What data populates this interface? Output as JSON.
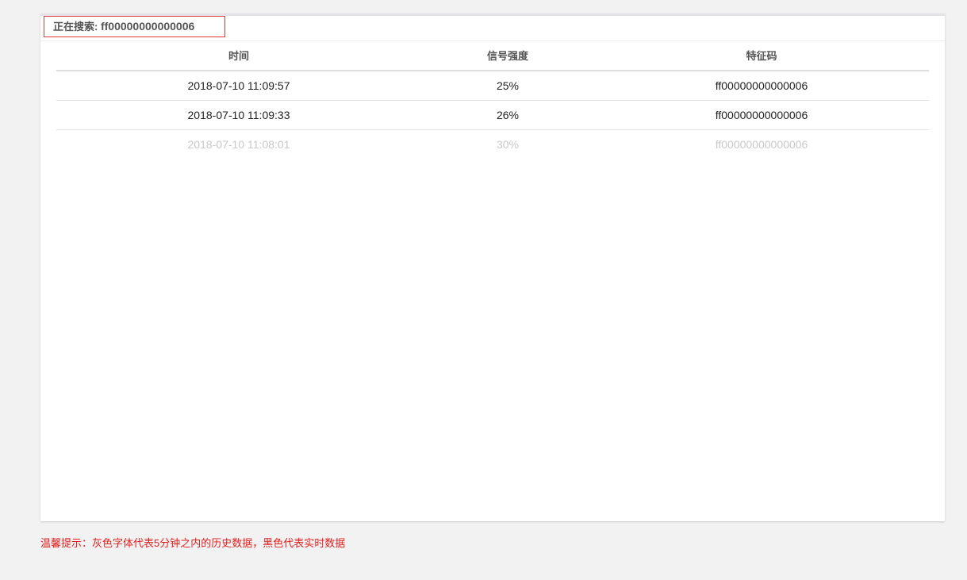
{
  "search": {
    "label": "正在搜索: ",
    "code": "ff00000000000006"
  },
  "table": {
    "headers": [
      "时间",
      "信号强度",
      "特征码"
    ],
    "rows": [
      {
        "time": "2018-07-10 11:09:57",
        "signal": "25%",
        "code": "ff00000000000006",
        "history": false
      },
      {
        "time": "2018-07-10 11:09:33",
        "signal": "26%",
        "code": "ff00000000000006",
        "history": false
      },
      {
        "time": "2018-07-10 11:08:01",
        "signal": "30%",
        "code": "ff00000000000006",
        "history": true
      }
    ]
  },
  "tip": "温馨提示：灰色字体代表5分钟之内的历史数据，黑色代表实时数据",
  "colors": {
    "accent_red": "#e02020",
    "history_gray": "#c8c8c8",
    "realtime_black": "#222222"
  }
}
